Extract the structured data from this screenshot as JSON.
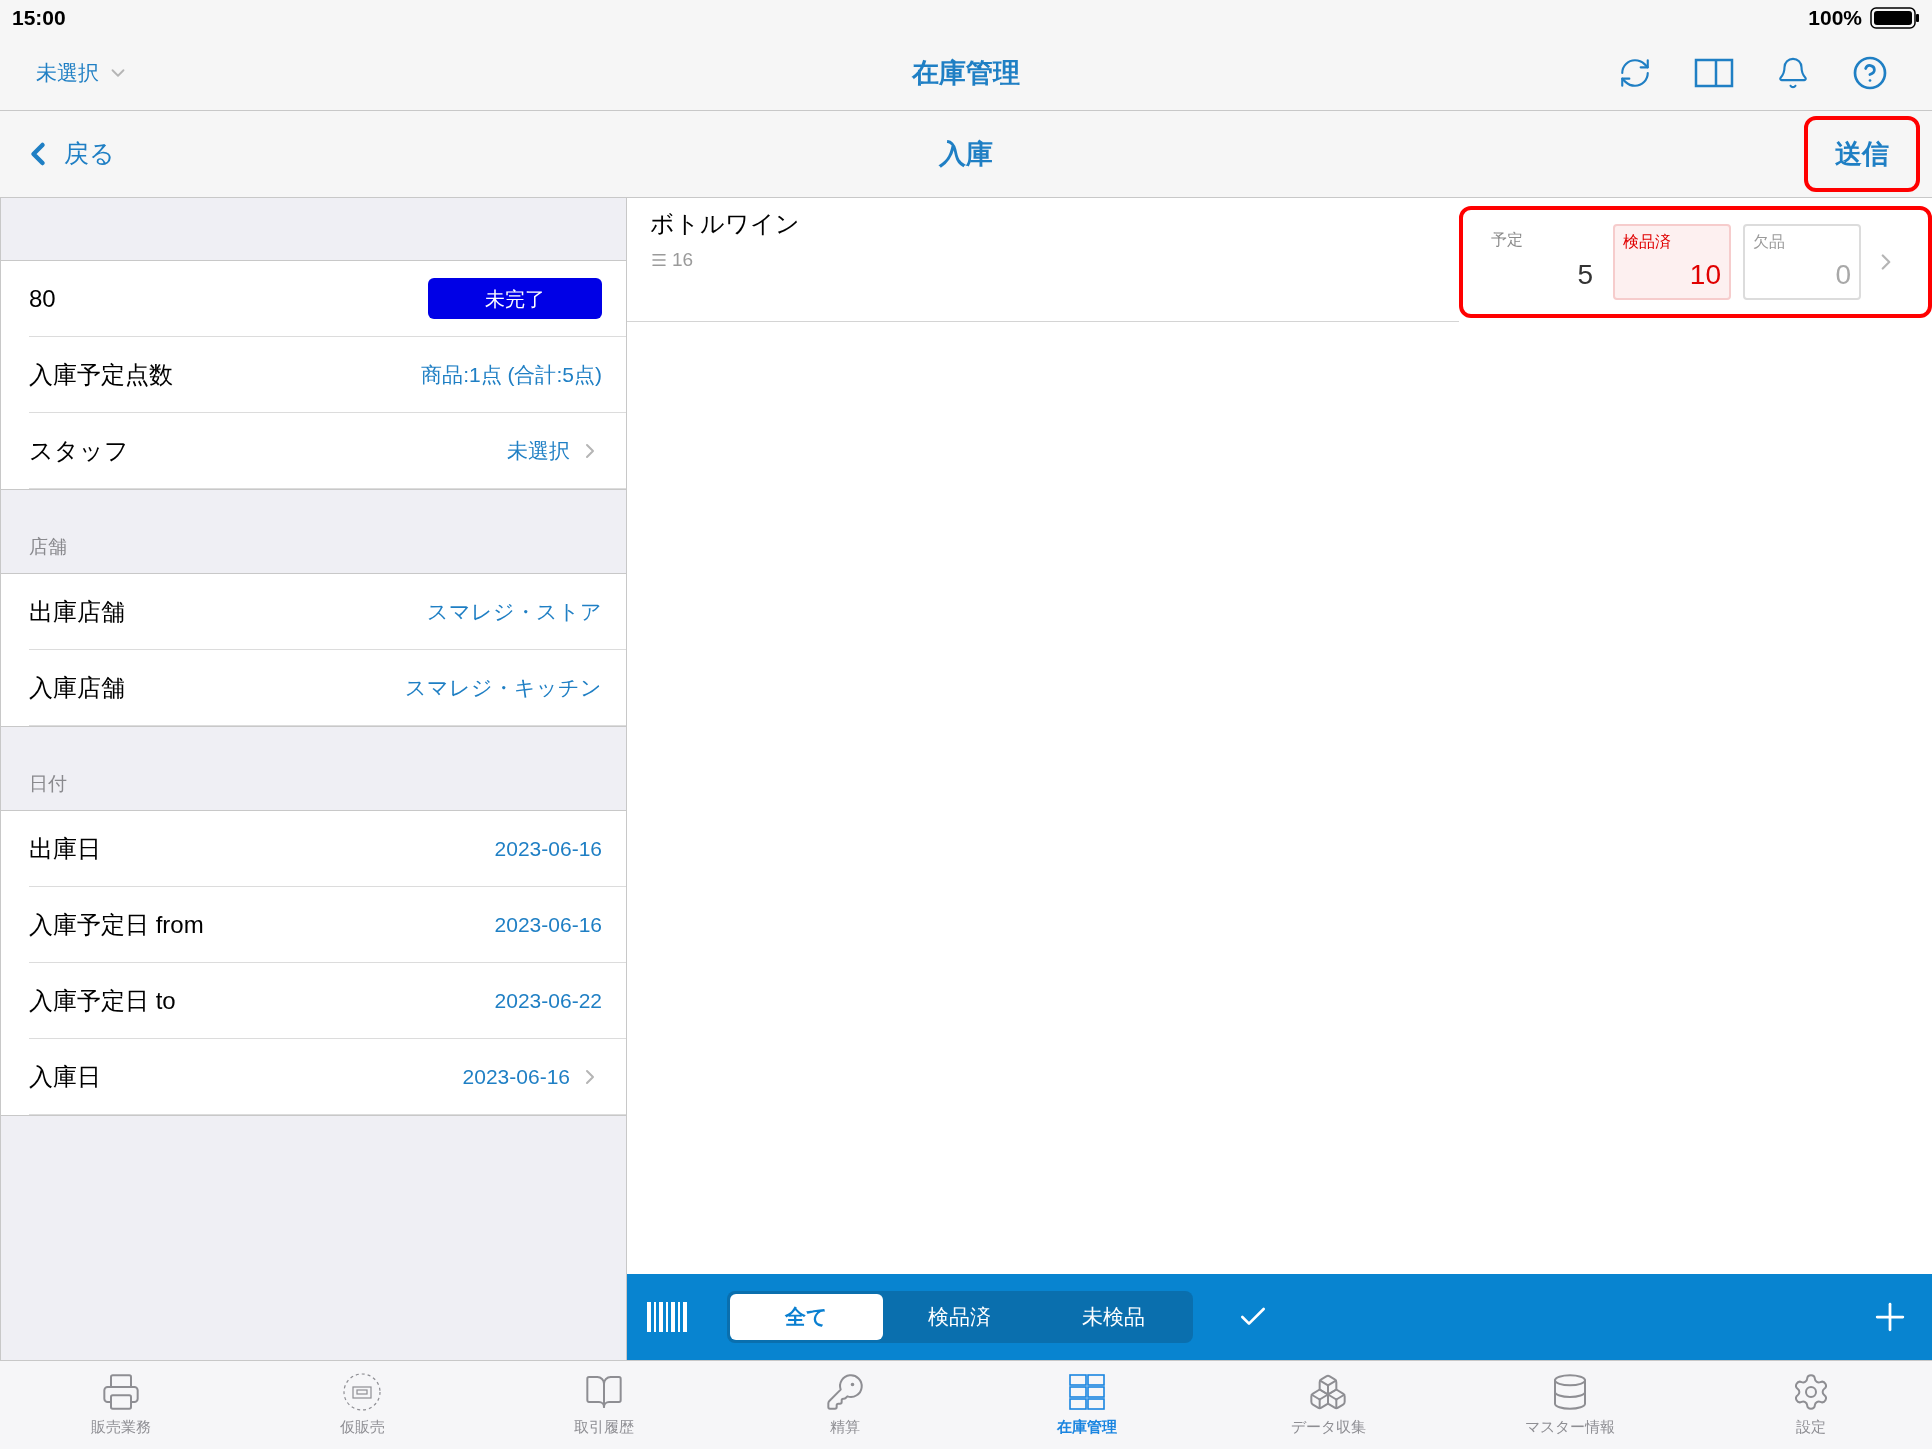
{
  "status_bar": {
    "time": "15:00",
    "battery": "100%"
  },
  "top_nav": {
    "store_selector": "未選択",
    "title": "在庫管理"
  },
  "sub_nav": {
    "back": "戻る",
    "title": "入庫",
    "action": "送信",
    "action_highlighted": true
  },
  "left_panel": {
    "sections": [
      {
        "rows": [
          {
            "kind": "status",
            "label": "80",
            "value": "未完了"
          },
          {
            "kind": "value",
            "label": "入庫予定点数",
            "value": "商品:1点 (合計:5点)"
          },
          {
            "kind": "value",
            "label": "スタッフ",
            "value": "未選択",
            "chevron": true
          }
        ]
      },
      {
        "header": "店舗",
        "rows": [
          {
            "kind": "value",
            "label": "出庫店舗",
            "value": "スマレジ・ストア"
          },
          {
            "kind": "value",
            "label": "入庫店舗",
            "value": "スマレジ・キッチン"
          }
        ]
      },
      {
        "header": "日付",
        "rows": [
          {
            "kind": "value",
            "label": "出庫日",
            "value": "2023-06-16"
          },
          {
            "kind": "value",
            "label": "入庫予定日 from",
            "value": "2023-06-16"
          },
          {
            "kind": "value",
            "label": "入庫予定日 to",
            "value": "2023-06-22"
          },
          {
            "kind": "value",
            "label": "入庫日",
            "value": "2023-06-16",
            "chevron": true
          }
        ]
      }
    ]
  },
  "item": {
    "name": "ボトルワイン",
    "code": "16",
    "counts_highlighted": true,
    "counts": [
      {
        "kind": "planned",
        "label": "予定",
        "value": "5"
      },
      {
        "kind": "checked",
        "label": "検品済",
        "value": "10"
      },
      {
        "kind": "missing",
        "label": "欠品",
        "value": "0"
      }
    ]
  },
  "toolbar": {
    "segments": [
      {
        "label": "全て",
        "selected": true
      },
      {
        "label": "検品済",
        "selected": false
      },
      {
        "label": "未検品",
        "selected": false
      }
    ]
  },
  "tab_bar": {
    "items": [
      {
        "label": "販売業務",
        "selected": false
      },
      {
        "label": "仮販売",
        "selected": false
      },
      {
        "label": "取引履歴",
        "selected": false
      },
      {
        "label": "精算",
        "selected": false
      },
      {
        "label": "在庫管理",
        "selected": true
      },
      {
        "label": "データ収集",
        "selected": false
      },
      {
        "label": "マスター情報",
        "selected": false
      },
      {
        "label": "設定",
        "selected": false
      }
    ]
  }
}
